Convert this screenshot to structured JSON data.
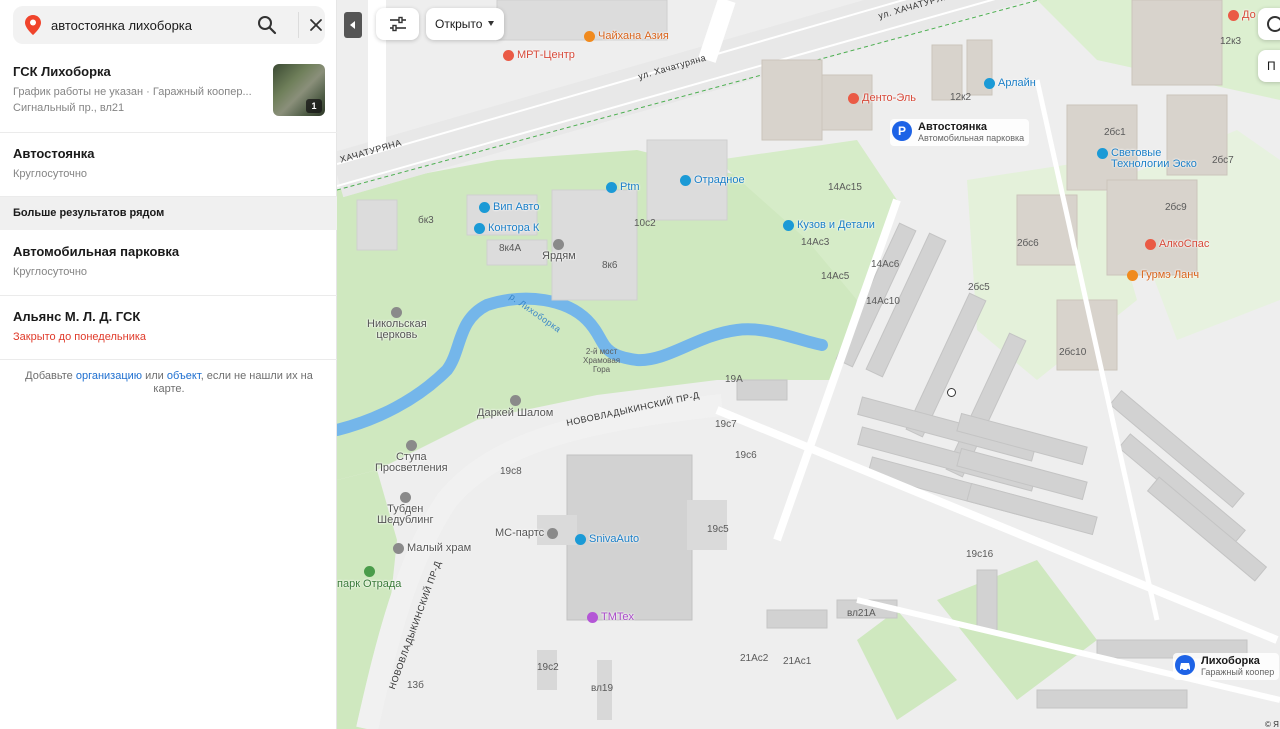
{
  "search": {
    "value": "автостоянка лихоборка",
    "placeholder": ""
  },
  "results": [
    {
      "title": "ГСК Лихоборка",
      "line1": "График работы не указан · Гаражный коопер...",
      "line2": "Сигнальный пр., вл21",
      "photo_count": "1"
    },
    {
      "title": "Автостоянка",
      "line1": "Круглосуточно"
    }
  ],
  "more_section_label": "Больше результатов рядом",
  "more_results": [
    {
      "title": "Автомобильная парковка",
      "line1": "Круглосуточно"
    },
    {
      "title": "Альянс М. Л. Д. ГСК",
      "line1": "Закрыто до понедельника"
    }
  ],
  "add_note": {
    "prefix": "Добавьте ",
    "org_link": "организацию",
    "mid": " или ",
    "obj_link": "объект",
    "suffix": ", если не нашли их на карте."
  },
  "map": {
    "filter_open_label": "Открыто",
    "right_control_label": "П",
    "pins": [
      {
        "id": "parking",
        "icon": "P",
        "title": "Автостоянка",
        "subtitle": "Автомобильная парковка"
      },
      {
        "id": "likhoborka",
        "icon": "car",
        "title": "Лихоборка",
        "subtitle": "Гаражный коопер"
      }
    ],
    "pois": [
      {
        "name": "МРТ-Центр",
        "kind": "red"
      },
      {
        "name": "Чайхана Азия",
        "kind": "orange"
      },
      {
        "name": "Денто-Эль",
        "kind": "red"
      },
      {
        "name": "Арлайн",
        "kind": "blue"
      },
      {
        "name": "Ptm",
        "kind": "blue"
      },
      {
        "name": "Отрадное",
        "kind": "blue"
      },
      {
        "name": "Вип Авто",
        "kind": "blue"
      },
      {
        "name": "Контора К",
        "kind": "blue"
      },
      {
        "name": "Кузов и Детали",
        "kind": "blue"
      },
      {
        "name": "Световые\nТехнологии Эско",
        "kind": "blue"
      },
      {
        "name": "АлкоСпас",
        "kind": "red"
      },
      {
        "name": "Гурмэ Ланч",
        "kind": "orange"
      },
      {
        "name": "SnivaAuto",
        "kind": "blue"
      },
      {
        "name": "TMTex",
        "kind": "violet"
      },
      {
        "name": "МС-партс",
        "kind": "grey"
      },
      {
        "name": "До",
        "kind": "red"
      }
    ],
    "landmarks": [
      {
        "name": "Ярдям"
      },
      {
        "name": "Никольская\nцерковь"
      },
      {
        "name": "Даркей Шалом"
      },
      {
        "name": "Ступа\nПросветления"
      },
      {
        "name": "Тубден\nШедублинг"
      },
      {
        "name": "Малый храм"
      },
      {
        "name": "парк Отрада"
      },
      {
        "name": "2-й мост\nХрамовая\nГора"
      }
    ],
    "streets": [
      {
        "name": "ул. Хачатуряна"
      },
      {
        "name": "ул. ХАЧАТУРЯНА"
      },
      {
        "name": "ХАЧАТУРЯНА"
      },
      {
        "name": "НОВОВЛАДЫКИНСКИЙ ПР-Д"
      },
      {
        "name": "НОВОВЛАДЫКИНСКИЙ ПР-Д"
      },
      {
        "name": "р. Лихоборка"
      }
    ],
    "house_numbers": [
      "12к3",
      "12к2",
      "2бс1",
      "2бс7",
      "14Ас15",
      "14Ас3",
      "14Ас5",
      "14Ас6",
      "14Ас10",
      "2бс6",
      "2бс5",
      "2бс9",
      "2бс10",
      "бк3",
      "8к4А",
      "8к6",
      "10с2",
      "19А",
      "19с7",
      "19с6",
      "19с8",
      "19с5",
      "19с16",
      "вл21А",
      "21Ас2",
      "21Ас1",
      "19с2",
      "вл19",
      "13б"
    ],
    "copyright": "© Я"
  }
}
